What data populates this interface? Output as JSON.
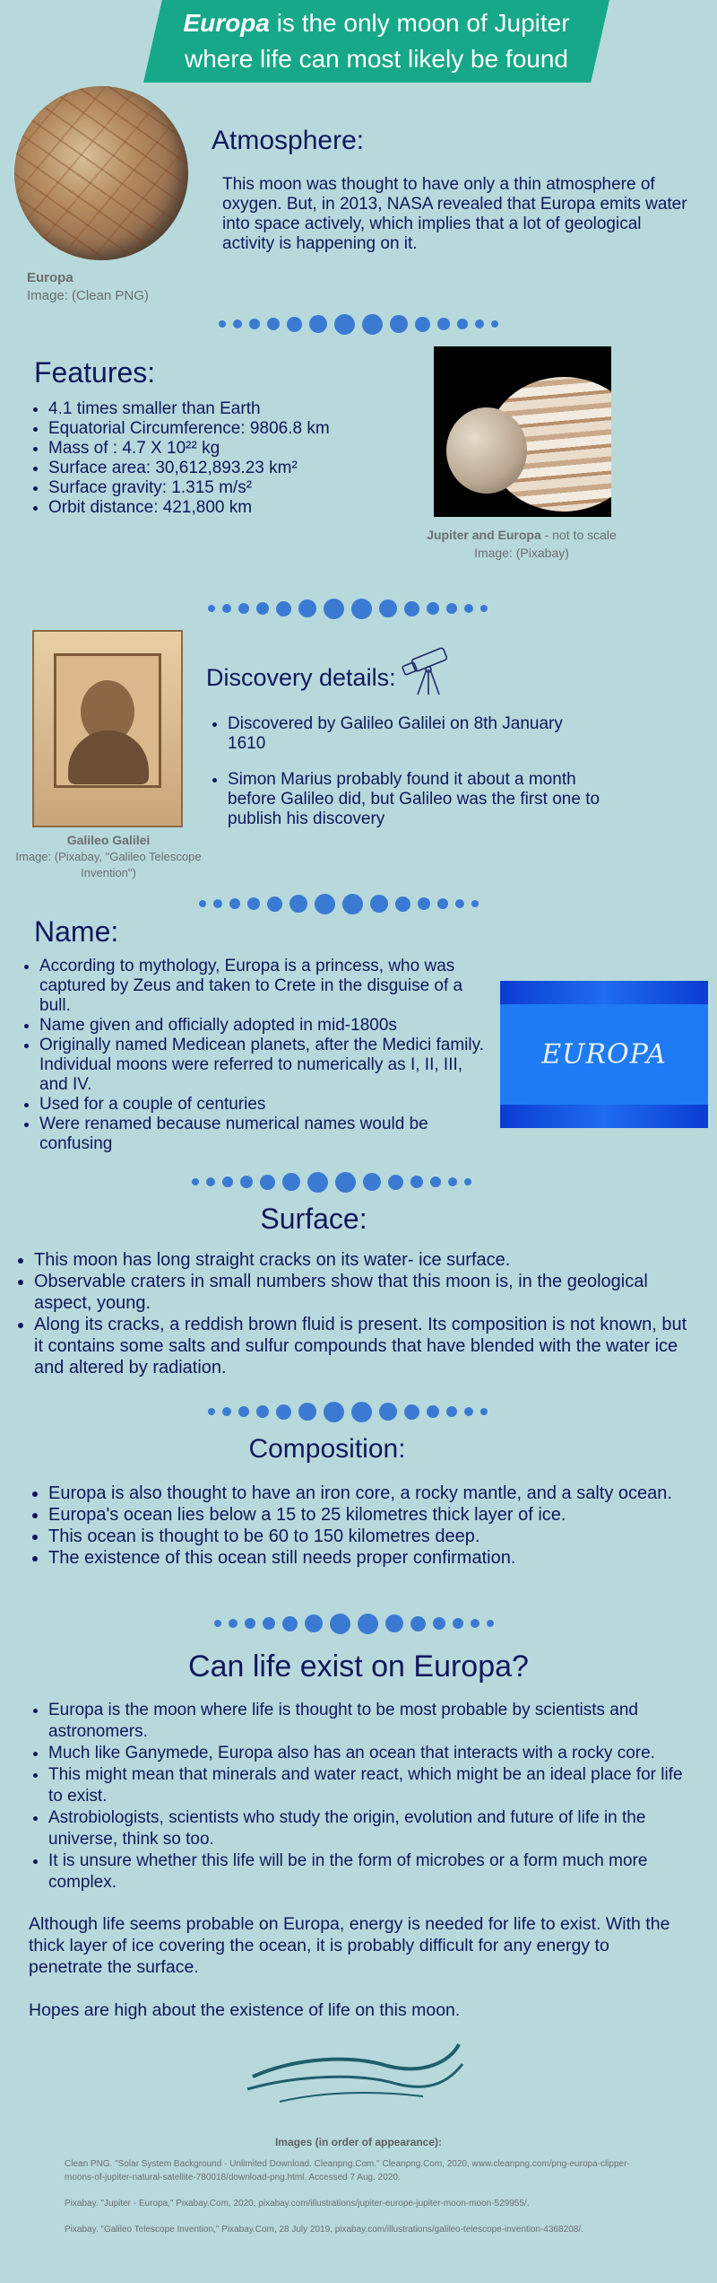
{
  "header": {
    "title_em": "Europa",
    "title_rest1": " is the only moon of Jupiter",
    "title_line2": "where life can most likely be found"
  },
  "atmosphere": {
    "title": "Atmosphere:",
    "text": "This moon was thought to have only a thin atmosphere of oxygen. But, in 2013, NASA revealed that Europa emits water into space actively, which implies that a lot of geological activity is happening on it.",
    "caption_name": "Europa",
    "caption_credit": "Image: (Clean PNG)"
  },
  "features": {
    "title": "Features:",
    "items": [
      "4.1 times smaller than Earth",
      "Equatorial Circumference: 9806.8 km",
      "Mass of : 4.7 X 10²² kg",
      "Surface area: 30,612,893.23 km²",
      "Surface gravity: 1.315 m/s²",
      "Orbit distance: 421,800 km"
    ],
    "caption_name": "Jupiter and Europa",
    "caption_note": " - not to scale",
    "caption_credit": "Image: (Pixabay)"
  },
  "discovery": {
    "title": "Discovery details:",
    "items": [
      "Discovered by Galileo Galilei on 8th January 1610",
      "Simon Marius probably found it about a month before Galileo did, but Galileo was the first one to publish his discovery"
    ],
    "caption_name": "Galileo Galilei",
    "caption_credit": "Image: (Pixabay, \"Galileo Telescope Invention\")"
  },
  "name": {
    "title": "Name:",
    "items": [
      "According to mythology, Europa is a princess, who was captured by Zeus and taken to Crete in the disguise of a bull.",
      "Name given and officially adopted in mid-1800s",
      "Originally named Medicean planets, after the Medici family. Individual moons were referred to numerically as I, II, III, and IV.",
      "Used for a couple of centuries",
      "Were renamed because numerical names would be confusing"
    ],
    "banner_text": "EUROPA"
  },
  "surface": {
    "title": "Surface:",
    "items": [
      "This moon has long straight cracks on its water- ice surface.",
      "Observable craters in small numbers show that this moon is, in the geological aspect, young.",
      "Along its cracks, a reddish brown fluid is present. Its composition is not known, but it contains some salts and sulfur compounds that have blended with the water ice and altered by radiation."
    ]
  },
  "composition": {
    "title": "Composition:",
    "items": [
      "Europa is also thought to have an iron core, a rocky mantle, and a salty ocean.",
      "Europa's ocean lies below a 15 to 25 kilometres thick layer of ice.",
      "This ocean is thought to be 60 to 150 kilometres deep.",
      "The existence of this ocean still needs proper confirmation."
    ]
  },
  "life": {
    "title": "Can life exist on Europa?",
    "items": [
      "Europa is the moon where life is thought to be most probable by scientists and astronomers.",
      "Much like Ganymede, Europa also has an ocean that interacts with a rocky core.",
      "This might mean that minerals and water react, which might be an ideal place for life to exist.",
      "Astrobiologists, scientists who study the origin, evolution and future of life in the universe, think so too.",
      "It is unsure whether this life will be in the form of microbes or a form much more complex."
    ],
    "para1": "Although life seems probable on Europa, energy is needed for life to exist. With the thick layer of ice covering the ocean, it is probably difficult for any energy to penetrate the surface.",
    "para2": "Hopes are high about the existence of life on this moon."
  },
  "references": {
    "title": "Images (in order of appearance):",
    "items": [
      "Clean PNG. \"Solar System Background - Unlimited Download. Cleanpng.Com.\" Cleanpng.Com, 2020, www.cleanpng.com/png-europa-clipper-moons-of-jupiter-natural-satellite-780018/download-png.html. Accessed 7 Aug. 2020.",
      "Pixabay. \"Jupiter - Europa,\" Pixabay.Com, 2020, pixabay.com/illustrations/jupiter-europe-jupiter-moon-moon-529955/.",
      "Pixabay. \"Galileo Telescope Invention,\" Pixabay.Com, 28 July 2019, pixabay.com/illustrations/galileo-telescope-invention-4368208/."
    ]
  },
  "colors": {
    "background": "#b7d9dc",
    "banner": "#17a889",
    "text": "#10175c",
    "dots": "#3b7ad3"
  },
  "icons": [
    "telescope-icon",
    "wave-flourish-icon"
  ]
}
